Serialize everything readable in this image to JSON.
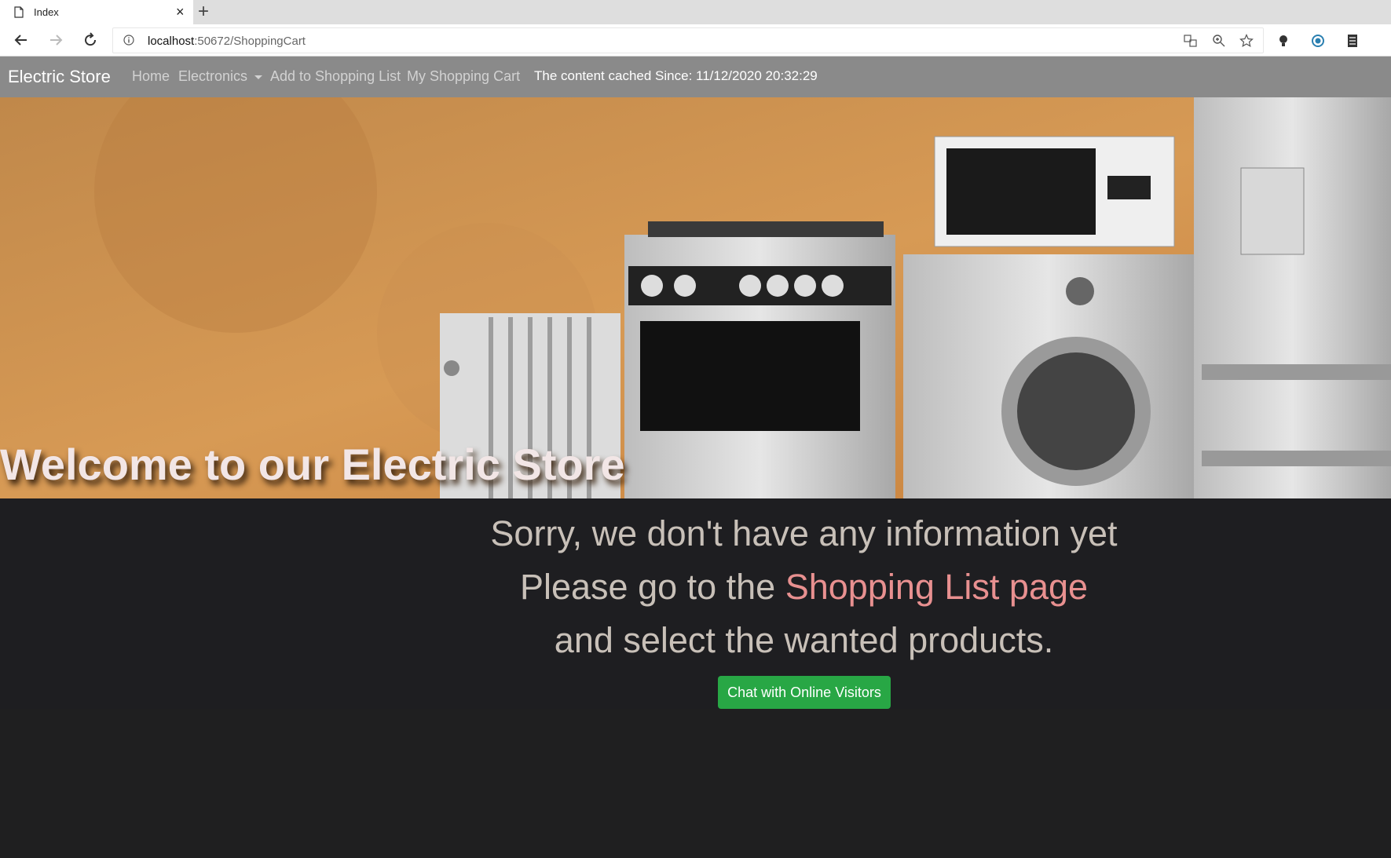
{
  "browser": {
    "tab_title": "Index",
    "close_label": "×",
    "new_tab_label": "+",
    "url_host": "localhost",
    "url_rest": ":50672/ShoppingCart"
  },
  "navbar": {
    "brand": "Electric Store",
    "links": [
      "Home",
      "Electronics",
      "Add to Shopping List",
      "My Shopping Cart"
    ],
    "cached_text": "The content cached Since: 11/12/2020 20:32:29"
  },
  "hero": {
    "title": "Welcome to our Electric Store"
  },
  "message": {
    "line1": "Sorry, we don't have any information yet",
    "line2_prefix": "Please go to the ",
    "line2_link": "Shopping List page",
    "line3": "and select the wanted products.",
    "button": "Chat with Online Visitors"
  },
  "colors": {
    "navbar_bg": "#8a8a8a",
    "body_bg": "#1f1f20",
    "button_bg": "#28a745",
    "link_color": "#e89090"
  }
}
